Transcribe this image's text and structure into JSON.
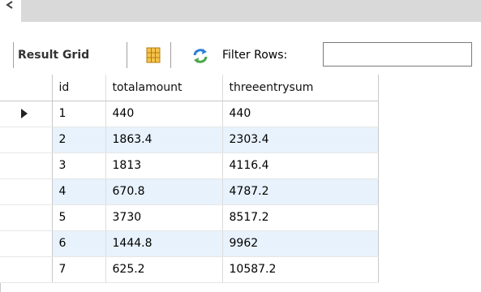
{
  "toolbar": {
    "result_grid_label": "Result Grid",
    "filter_label": "Filter Rows:",
    "filter_value": ""
  },
  "grid": {
    "columns": [
      "id",
      "totalamount",
      "threeentrysum"
    ],
    "rows": [
      {
        "id": "1",
        "totalamount": "440",
        "threeentrysum": "440"
      },
      {
        "id": "2",
        "totalamount": "1863.4",
        "threeentrysum": "2303.4"
      },
      {
        "id": "3",
        "totalamount": "1813",
        "threeentrysum": "4116.4"
      },
      {
        "id": "4",
        "totalamount": "670.8",
        "threeentrysum": "4787.2"
      },
      {
        "id": "5",
        "totalamount": "3730",
        "threeentrysum": "8517.2"
      },
      {
        "id": "6",
        "totalamount": "1444.8",
        "threeentrysum": "9962"
      },
      {
        "id": "7",
        "totalamount": "625.2",
        "threeentrysum": "10587.2"
      }
    ]
  },
  "icons": {
    "scroll_left": "chevron-left-icon",
    "grid_view": "grid-view-icon",
    "refresh": "refresh-icon",
    "current_row": "row-pointer-icon"
  },
  "colors": {
    "alt_row": "#e8f2fc",
    "scroll_track": "#d9d9d9",
    "refresh_accent": "#2f7fd6"
  }
}
